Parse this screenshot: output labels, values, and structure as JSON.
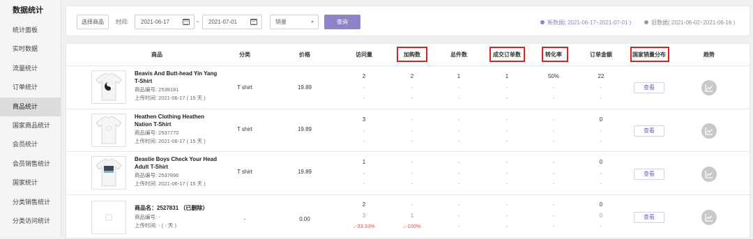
{
  "sidebar": {
    "title": "数据统计",
    "items": [
      {
        "label": "统计面板"
      },
      {
        "label": "实时数据"
      },
      {
        "label": "流量统计"
      },
      {
        "label": "订单统计"
      },
      {
        "label": "商品统计",
        "active": true
      },
      {
        "label": "国家商品统计"
      },
      {
        "label": "会员统计"
      },
      {
        "label": "会员销售统计"
      },
      {
        "label": "国家统计"
      },
      {
        "label": "分类销售统计"
      },
      {
        "label": "分类访问统计"
      }
    ]
  },
  "filter": {
    "select_product": "选择商品",
    "time_label": "时间:",
    "date_start": "2021-06-17",
    "date_separator": "~",
    "date_end": "2021-07-01",
    "sort_select": "销量",
    "query_button": "查询",
    "legend_new": "新数据( 2021-06-17~2021-07-01 )",
    "legend_old": "旧数据( 2021-06-02~2021-06-16 )",
    "legend_new_color": "#8c84c9",
    "legend_old_color": "#999999"
  },
  "table": {
    "headers": {
      "product": "商品",
      "category": "分类",
      "price": "价格",
      "visits": "访问量",
      "cart": "加购数",
      "pieces": "总件数",
      "orders": "成交订单数",
      "conversion": "转化率",
      "amount": "订单金额",
      "country_dist": "国家销量分布",
      "trend": "趋势"
    },
    "rows": [
      {
        "name_lines": [
          "Beavis And Butt-head Yin Yang",
          "T-Shirt"
        ],
        "code": "商品编号: 2538181",
        "upload": "上传时间: 2021-06-17 ( 15 天 )",
        "category": "T shirt",
        "price": "19.89",
        "visits": [
          "2",
          "-",
          "-"
        ],
        "cart": [
          "2",
          "-",
          "-"
        ],
        "pieces": [
          "1",
          "-",
          "-"
        ],
        "orders": [
          "1",
          "-",
          "-"
        ],
        "conversion": [
          "50%",
          "-",
          "-"
        ],
        "amount": [
          "22",
          "-",
          "-"
        ],
        "view": "查看",
        "image": "shirt-yinyang"
      },
      {
        "name_lines": [
          "Heathen Clothing Heathen",
          "Nation T-Shirt"
        ],
        "code": "商品编号: 2537770",
        "upload": "上传时间: 2021-06-17 ( 15 天 )",
        "category": "T shirt",
        "price": "19.89",
        "visits": [
          "3",
          "-",
          "-"
        ],
        "cart": [
          "-",
          "-",
          "-"
        ],
        "pieces": [
          "-",
          "-",
          "-"
        ],
        "orders": [
          "-",
          "-",
          "-"
        ],
        "conversion": [
          "-",
          "-",
          "-"
        ],
        "amount": [
          "0",
          "-",
          "-"
        ],
        "view": "查看",
        "image": "shirt-white"
      },
      {
        "name_lines": [
          "Beastie Boys Check Your Head",
          "Adult T-Shirt"
        ],
        "code": "商品编号: 2537896",
        "upload": "上传时间: 2021-06-17 ( 15 天 )",
        "category": "T shirt",
        "price": "19.89",
        "visits": [
          "1",
          "-",
          "-"
        ],
        "cart": [
          "-",
          "-",
          "-"
        ],
        "pieces": [
          "-",
          "-",
          "-"
        ],
        "orders": [
          "-",
          "-",
          "-"
        ],
        "conversion": [
          "-",
          "-",
          "-"
        ],
        "amount": [
          "0",
          "-",
          "-"
        ],
        "view": "查看",
        "image": "shirt-photo"
      },
      {
        "name_lines": [
          "商品名：2527831 （已删除）"
        ],
        "code": "商品编号: -",
        "upload": "上传时间: - ( - 天 )",
        "category": "-",
        "price": "0.00",
        "visits": [
          "2",
          "3",
          "↓-33.33%"
        ],
        "cart": [
          "-",
          "1",
          "↓-100%"
        ],
        "pieces": [
          "-",
          "-",
          "-"
        ],
        "orders": [
          "-",
          "-",
          "-"
        ],
        "conversion": [
          "-",
          "-",
          "-"
        ],
        "amount": [
          "0",
          "0",
          "-"
        ],
        "view": "查看",
        "image": "placeholder"
      }
    ]
  }
}
